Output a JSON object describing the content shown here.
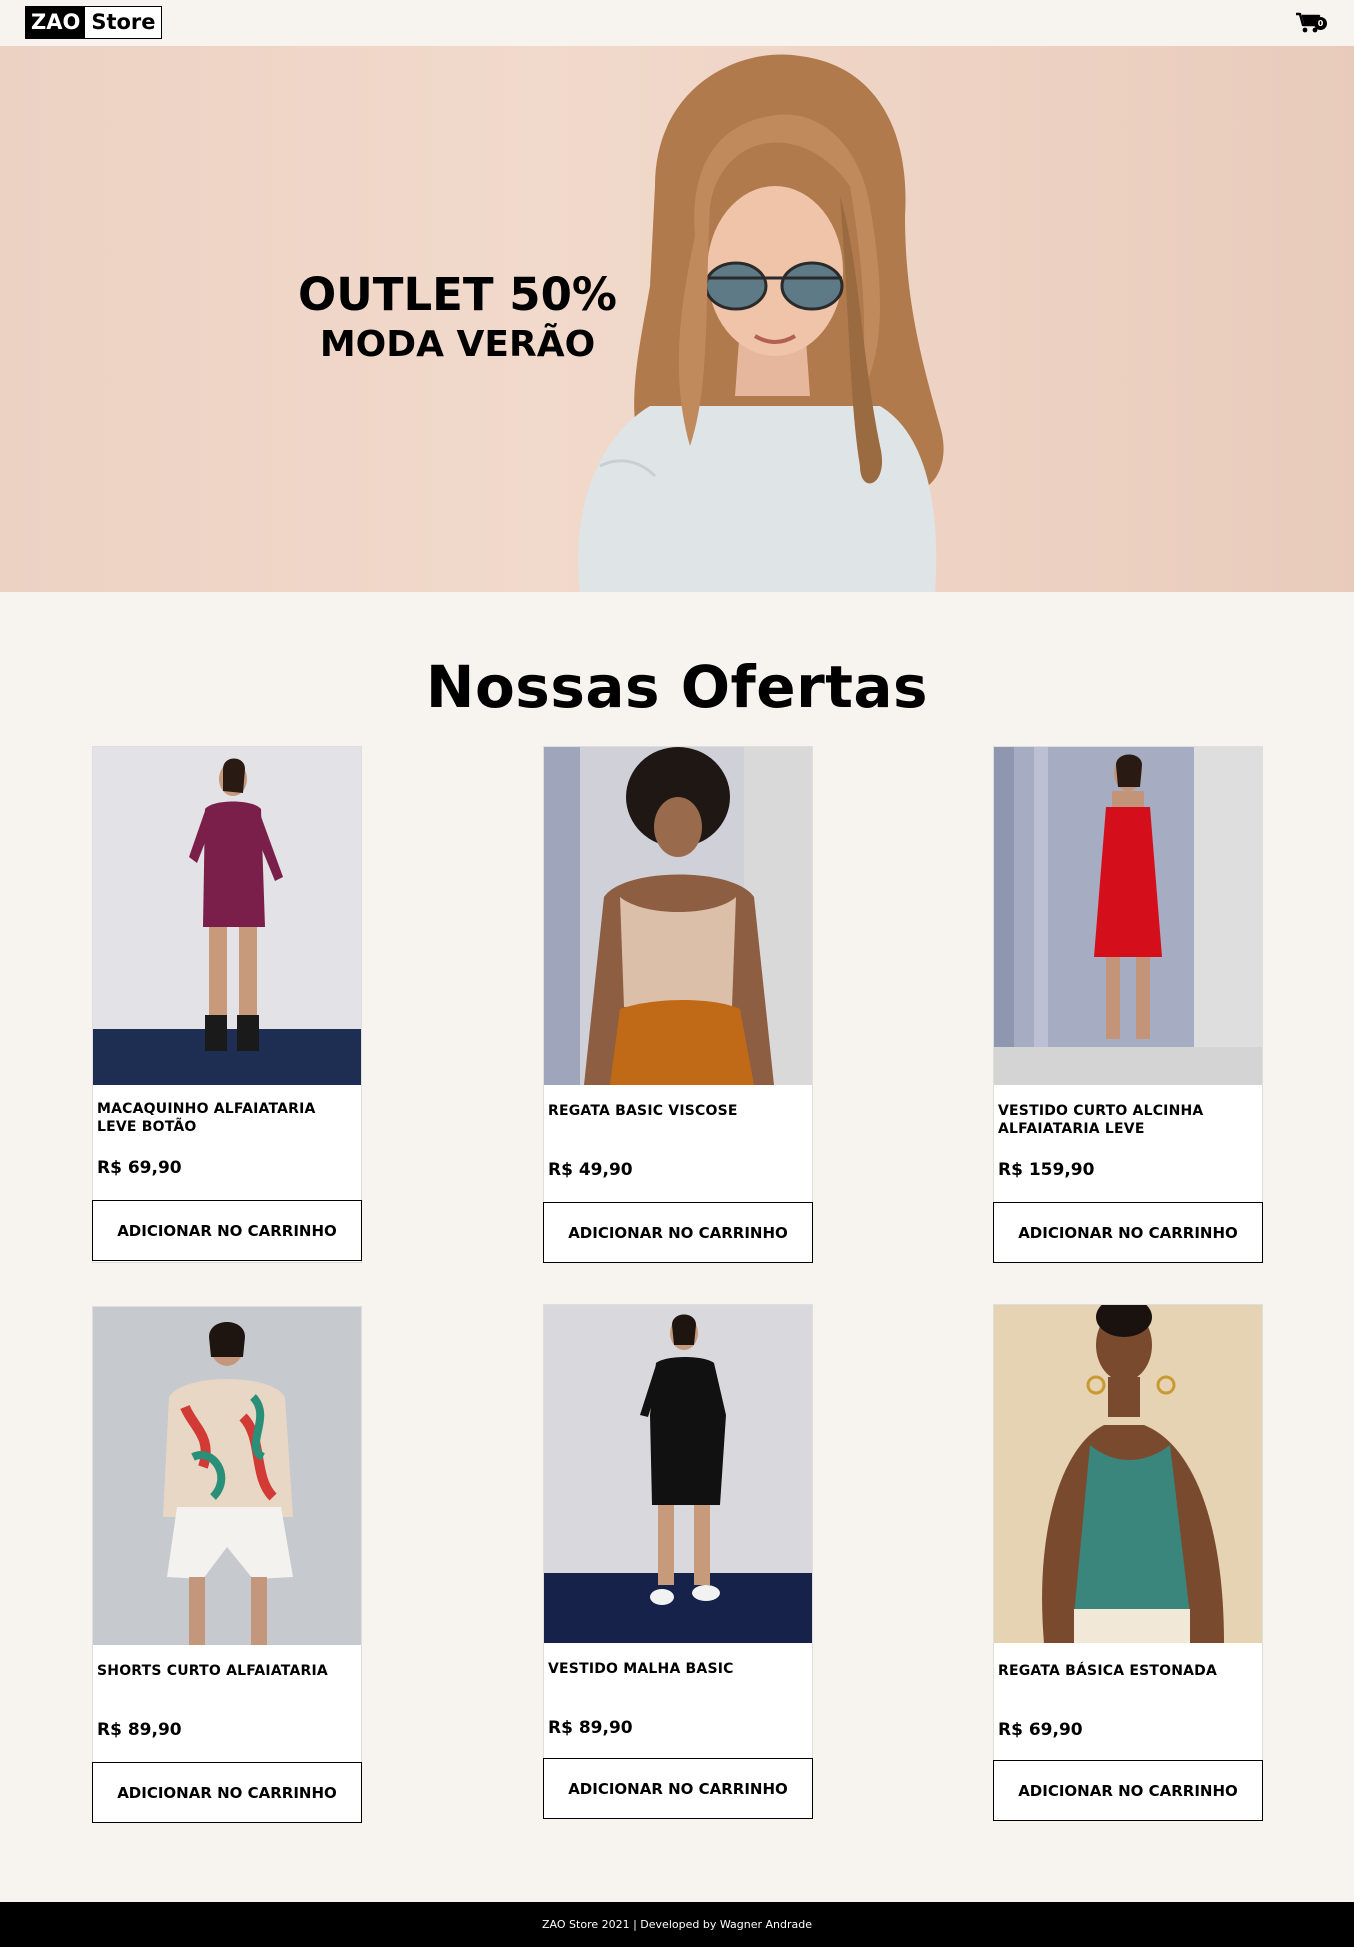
{
  "header": {
    "logo_part1": "ZAO",
    "logo_part2": "Store",
    "cart_count": "0",
    "cart_icon": "shopping-cart-icon"
  },
  "hero": {
    "title": "OUTLET 50%",
    "subtitle": "MODA VERÃO"
  },
  "offers": {
    "title": "Nossas Ofertas",
    "products": [
      {
        "name": "MACAQUINHO ALFAIATARIA LEVE BOTÃO",
        "price": "R$ 69,90",
        "button": "ADICIONAR NO CARRINHO"
      },
      {
        "name": "REGATA BASIC VISCOSE",
        "price": "R$ 49,90",
        "button": "ADICIONAR NO CARRINHO"
      },
      {
        "name": "VESTIDO CURTO ALCINHA ALFAIATARIA LEVE",
        "price": "R$ 159,90",
        "button": "ADICIONAR NO CARRINHO"
      },
      {
        "name": "SHORTS CURTO ALFAIATARIA",
        "price": "R$ 89,90",
        "button": "ADICIONAR NO CARRINHO"
      },
      {
        "name": "VESTIDO MALHA BASIC",
        "price": "R$ 89,90",
        "button": "ADICIONAR NO CARRINHO"
      },
      {
        "name": "REGATA BÁSICA ESTONADA",
        "price": "R$ 69,90",
        "button": "ADICIONAR NO CARRINHO"
      }
    ]
  },
  "footer": {
    "text": "ZAO Store 2021 | Developed by Wagner Andrade"
  }
}
